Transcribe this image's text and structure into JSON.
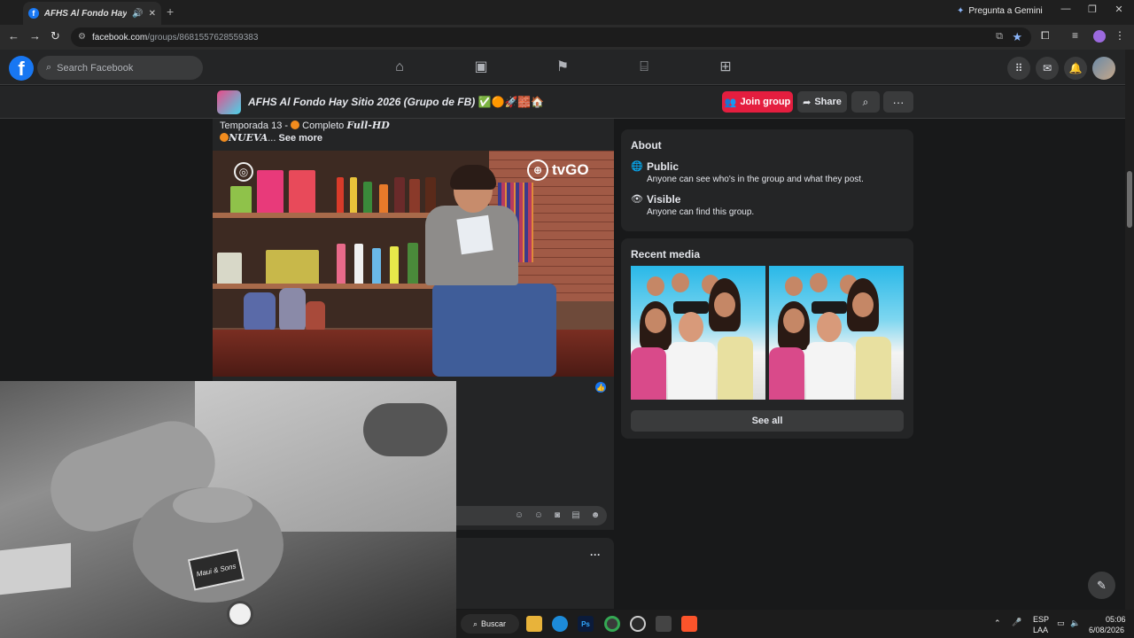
{
  "browser": {
    "tab_title": "AFHS Al Fondo Hay Sitio",
    "tab_close": "✕",
    "new_tab": "+",
    "gemini_label": "Pregunta a Gemini",
    "url_domain": "facebook.com",
    "url_path": "/groups/8681557628559383"
  },
  "fb": {
    "logo": "f",
    "search_placeholder": "Search Facebook",
    "nav_icons": [
      "home-icon",
      "video-icon",
      "pages-flag-icon",
      "marketplace-icon",
      "gaming-icon"
    ]
  },
  "group": {
    "name": "AFHS Al Fondo Hay Sitio 2026 (Grupo de FB)",
    "name_emoji": "✅🟠🚀🧱🏠",
    "join_label": "Join group",
    "share_label": "Share"
  },
  "post": {
    "line1_prefix": "Temporada 13 - ",
    "line1_mid": " Completo ",
    "line1_fullhd": "Full-HD",
    "line2_nueva": "NUEVA",
    "line2_ellipsis": "...",
    "see_more": "See more",
    "video_brand": "tvGO"
  },
  "about": {
    "title": "About",
    "items": [
      {
        "icon": "globe-icon",
        "label": "Public",
        "description": "Anyone can see who's in the group and what they post."
      },
      {
        "icon": "eye-icon",
        "label": "Visible",
        "description": "Anyone can find this group."
      }
    ]
  },
  "recent_media": {
    "title": "Recent media",
    "see_all": "See all"
  },
  "webcam": {
    "patch_text": "Maui & Sons"
  },
  "taskbar": {
    "search_label": "Buscar",
    "ps_label": "Ps",
    "lang_line1": "ESP",
    "lang_line2": "LAA",
    "time": "05:06",
    "date": "6/08/2026"
  },
  "colors": {
    "fb_blue": "#1877f2",
    "join_red": "#e41e3f",
    "surface": "#242526",
    "background": "#18191a"
  }
}
